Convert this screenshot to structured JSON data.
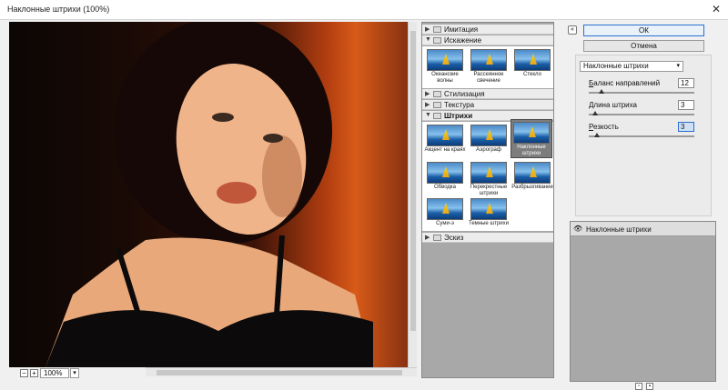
{
  "window": {
    "title": "Наклонные штрихи (100%)",
    "close_glyph": "✕"
  },
  "preview": {
    "zoom": "100%",
    "zoom_out": "−",
    "zoom_in": "+"
  },
  "gallery": {
    "categories": [
      {
        "name": "Имитация",
        "expanded": false
      },
      {
        "name": "Искажение",
        "expanded": true,
        "items": [
          "Океанские волны",
          "Рассеянное свечение",
          "Стекло"
        ]
      },
      {
        "name": "Стилизация",
        "expanded": false
      },
      {
        "name": "Текстура",
        "expanded": false
      },
      {
        "name": "Штрихи",
        "expanded": true,
        "items": [
          "Акцент на краях",
          "Аэрограф",
          "Наклонные штрихи",
          "Обводка",
          "Перекрестные штрихи",
          "Разбрызгивание",
          "Суми-э",
          "Темные штрихи"
        ],
        "selected": "Наклонные штрихи"
      },
      {
        "name": "Эскиз",
        "expanded": false
      }
    ]
  },
  "buttons": {
    "ok": "ОК",
    "cancel": "Отмена",
    "collapse": "«"
  },
  "settings": {
    "filter": "Наклонные штрихи",
    "params": [
      {
        "label_u": "Б",
        "label_rest": "аланс направлений",
        "value": "12",
        "slider": 0.12
      },
      {
        "label_u": "Д",
        "label_rest": "лина штриха",
        "value": "3",
        "slider": 0.06
      },
      {
        "label_u": "Р",
        "label_rest": "езкость",
        "value": "3",
        "slider": 0.08
      }
    ]
  },
  "layers": {
    "items": [
      {
        "name": "Наклонные штрихи",
        "visible": true
      }
    ],
    "new_icon": "▫",
    "delete_icon": "▪"
  }
}
